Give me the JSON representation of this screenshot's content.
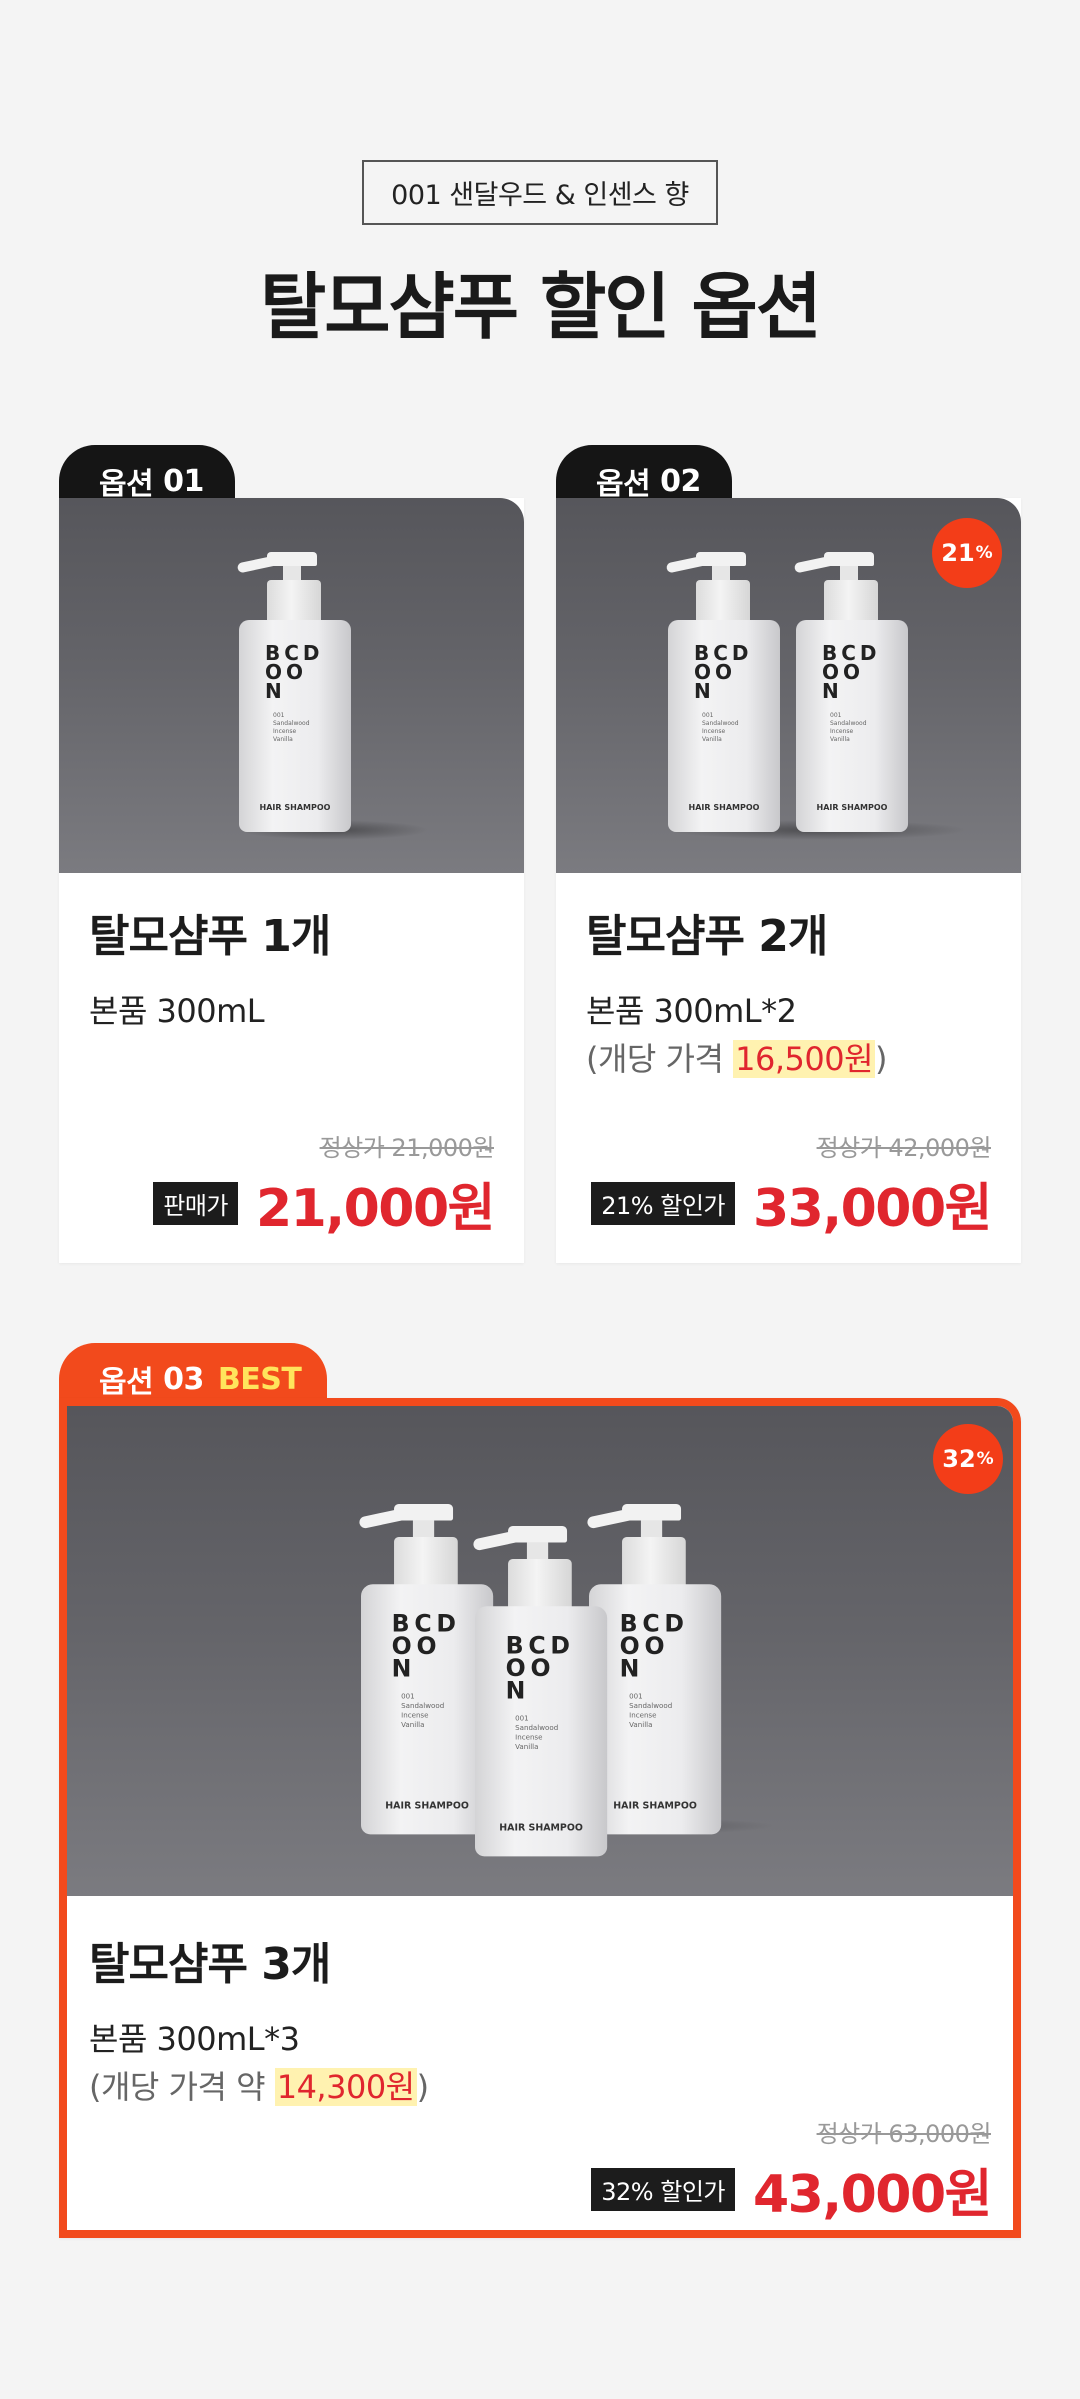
{
  "header": {
    "tag": "001 샌달우드 & 인센스 향",
    "title": "탈모샴푸 할인 옵션"
  },
  "bottle": {
    "logo_line1": "BCD",
    "logo_line2": "OO",
    "logo_line3": "N",
    "sub_num": "001",
    "sub_line1": "Sandalwood",
    "sub_line2": "Incense",
    "sub_line3": "Vanilla",
    "bottom_label": "HAIR SHAMPOO"
  },
  "options": [
    {
      "tab_label": "옵션",
      "tab_num": "01",
      "name": "탈모샴푸 1개",
      "spec": "본품 300mL",
      "original_price": "정상가 21,000원",
      "price_label": "판매가",
      "price": "21,000원"
    },
    {
      "tab_label": "옵션",
      "tab_num": "02",
      "badge_num": "21",
      "badge_unit": "%",
      "name": "탈모샴푸 2개",
      "spec": "본품 300mL*2",
      "unit_prefix": "(개당 가격 ",
      "unit_price": "16,500원",
      "unit_suffix": ")",
      "original_price": "정상가 42,000원",
      "price_label": "21% 할인가",
      "price": "33,000원"
    },
    {
      "tab_label": "옵션",
      "tab_num": "03",
      "best_label": "BEST",
      "badge_num": "32",
      "badge_unit": "%",
      "name": "탈모샴푸 3개",
      "spec": "본품 300mL*3",
      "unit_prefix": "(개당 가격 약 ",
      "unit_price": "14,300원",
      "unit_suffix": ")",
      "original_price": "정상가 63,000원",
      "price_label": "32% 할인가",
      "price": "43,000원"
    }
  ],
  "colors": {
    "accent": "#f24a1c",
    "price": "#e0262e",
    "highlight": "#fff2b0",
    "dark": "#151515"
  }
}
